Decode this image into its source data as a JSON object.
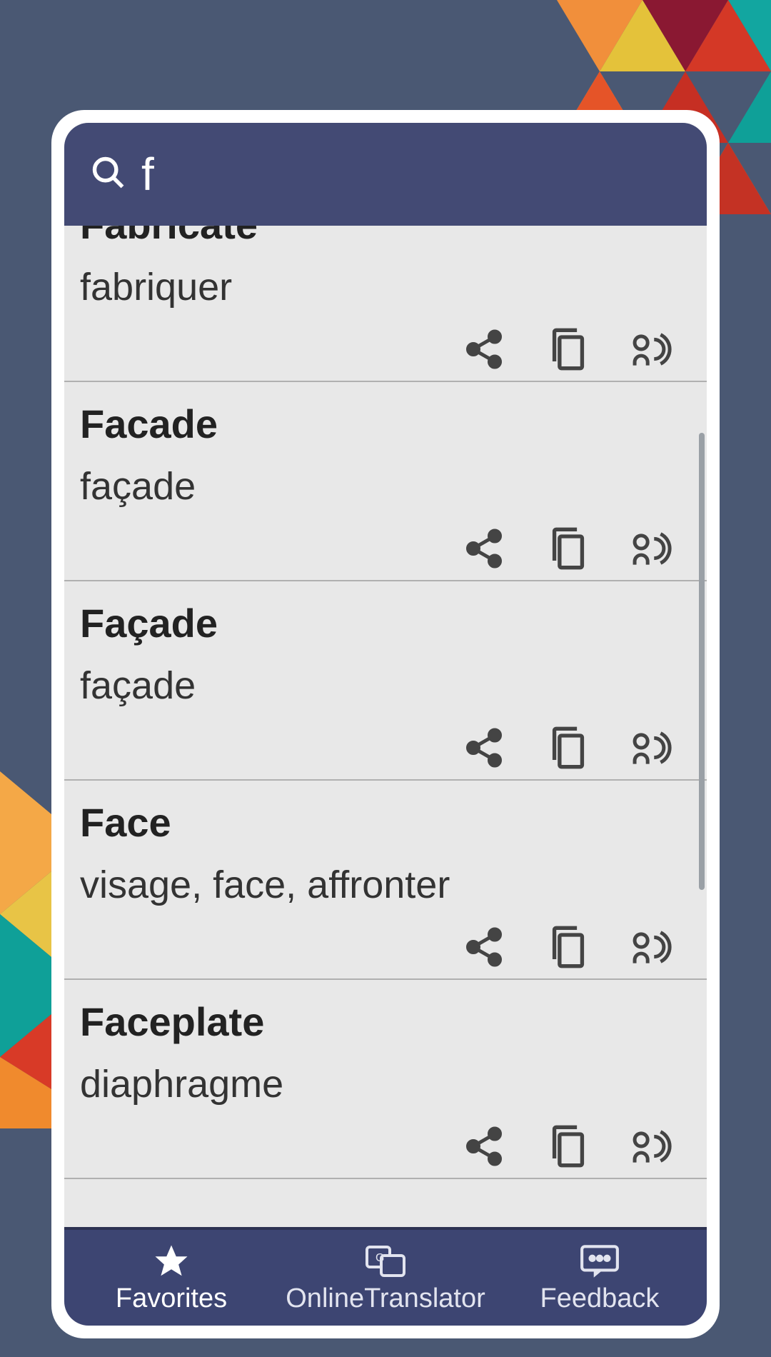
{
  "search": {
    "query": "f"
  },
  "items": [
    {
      "word": "Fabricate",
      "translation": "fabriquer"
    },
    {
      "word": "Facade",
      "translation": "façade"
    },
    {
      "word": "Façade",
      "translation": "façade"
    },
    {
      "word": "Face",
      "translation": "visage, face, affronter"
    },
    {
      "word": "Faceplate",
      "translation": "diaphragme"
    }
  ],
  "nav": {
    "favorites": "Favorites",
    "translator": "OnlineTranslator",
    "feedback": "Feedback"
  }
}
